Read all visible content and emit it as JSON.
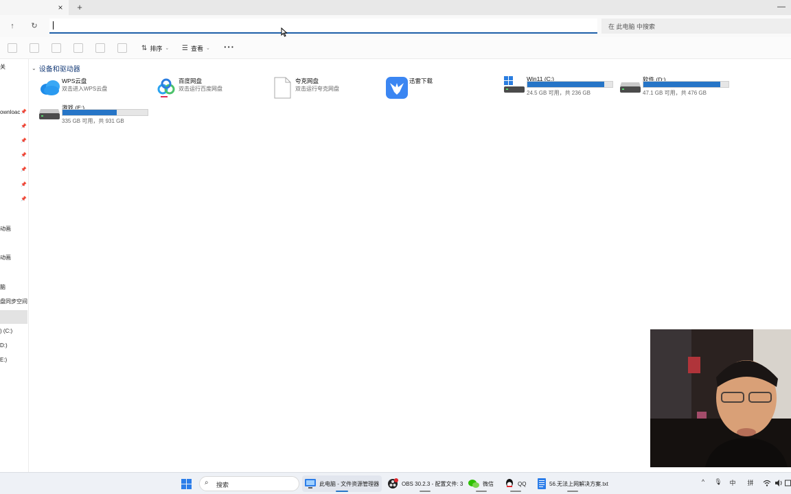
{
  "tabstrip": {
    "close_glyph": "×",
    "add_glyph": "+",
    "minimize_glyph": "—"
  },
  "navigation": {
    "up_glyph": "↑",
    "refresh_glyph": "↻",
    "address_value": "",
    "search_placeholder": "在 此电脑 中搜索"
  },
  "command_bar": {
    "disabled_icons": [
      "cut-icon",
      "copy-icon",
      "paste-icon",
      "rename-icon",
      "share-icon",
      "delete-icon"
    ],
    "sort_label": "排序",
    "view_label": "查看",
    "more_glyph": "···"
  },
  "sidebar": {
    "items": [
      {
        "label": "关"
      },
      {
        "label": "ownloac",
        "pinned": true
      },
      {
        "label": "",
        "pinned": true
      },
      {
        "label": "",
        "pinned": true
      },
      {
        "label": "",
        "pinned": true
      },
      {
        "label": "",
        "pinned": true
      },
      {
        "label": "",
        "pinned": true
      },
      {
        "label": "",
        "pinned": true
      },
      {
        "label": "动画"
      },
      {
        "label": "动画"
      },
      {
        "label": "脑"
      },
      {
        "label": "盘同步空间"
      },
      {
        "label": ""
      },
      {
        "label": ") (C:)"
      },
      {
        "label": "D:)"
      },
      {
        "label": "E:)"
      }
    ]
  },
  "main": {
    "group_header": "设备和驱动器",
    "apps": [
      {
        "name": "WPS云盘",
        "subtitle": "双击进入WPS云盘",
        "icon": "wps-cloud-icon"
      },
      {
        "name": "百度网盘",
        "subtitle": "双击运行百度网盘",
        "icon": "baidu-netdisk-icon"
      },
      {
        "name": "夸克网盘",
        "subtitle": "双击运行夸克网盘",
        "icon": "file-icon"
      },
      {
        "name": "迅雷下载",
        "subtitle": "",
        "icon": "xunlei-icon"
      }
    ],
    "drives": [
      {
        "name": "Win11 (C:)",
        "used_fraction": 0.9,
        "status": "24.5 GB 可用，共 236 GB",
        "icon": "windows-drive-icon"
      },
      {
        "name": "软件 (D:)",
        "used_fraction": 0.9,
        "status": "47.1 GB 可用，共 476 GB",
        "icon": "drive-icon"
      },
      {
        "name": "游戏 (E:)",
        "used_fraction": 0.64,
        "status": "335 GB 可用，共 931 GB",
        "icon": "drive-icon"
      }
    ]
  },
  "taskbar": {
    "search_label": "搜索",
    "apps": [
      {
        "label": "此电脑 - 文件资源管理器",
        "icon": "file-explorer-icon",
        "active": true
      },
      {
        "label": "OBS 30.2.3 - 配置文件: 3",
        "icon": "obs-icon"
      },
      {
        "label": "微信",
        "icon": "wechat-icon"
      },
      {
        "label": "QQ",
        "icon": "qq-icon"
      },
      {
        "label": "56.无法上网解决方案.txt",
        "icon": "notepad-icon"
      }
    ],
    "tray": {
      "chevron": "^",
      "mic": "🎙",
      "lang": "中",
      "ime": "拼"
    }
  },
  "colors": {
    "accent": "#2675c7",
    "link": "#1a3f7a"
  }
}
